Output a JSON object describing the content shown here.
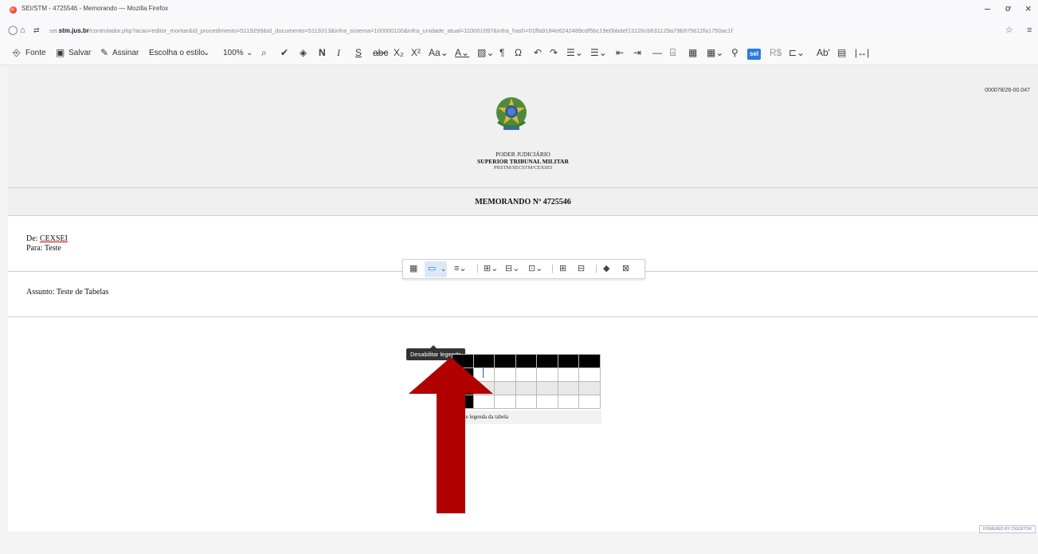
{
  "window": {
    "title": "SEI/STM - 4725546 - Memorando — Mozilla Firefox",
    "minimize": "–",
    "maximize": "ơ",
    "close": "×"
  },
  "address_bar": {
    "domain": "sei.stm.jus.br",
    "prefix": "sei.",
    "domain_bold": "stm.jus.br",
    "path": "/controlador.php?acao=editor_montar&id_procedimento=5119299&id_documento=5119313&infra_sistema=100000100&infra_unidade_atual=110001097&infra_hash=01ffa9184e6242489cdf5bc19e0bbdef13126cb631129a79b975612fa1750ac1f",
    "back_icon": "○",
    "lock_icon": "🔒",
    "star_icon": "☆",
    "menu_icon": "≡"
  },
  "toolbar": {
    "fonte": "Fonte",
    "salvar": "Salvar",
    "assinar": "Assinar",
    "style_select": "Escolha o estilo",
    "zoom": "100%",
    "sel_badge": "sel"
  },
  "document": {
    "doc_number": "000078/26-00.047",
    "header_line1": "PODER JUDICIÁRIO",
    "header_line2": "SUPERIOR TRIBUNAL MILITAR",
    "header_line3": "PRSTM/SECSTM/CEXSEI",
    "memo_title": "MEMORANDO Nº 4725546",
    "de_label": "De:",
    "de_value": "CEXSEI",
    "para_label": "Para:",
    "para_value": "Teste",
    "assunto": "Assunto: Teste de Tabelas",
    "table_caption": "Teste legenda da tabela"
  },
  "table_toolbar": {
    "tooltip": "Desabilitar legenda"
  },
  "footer": {
    "powered": "POWERED BY CKEDITOR"
  },
  "annotation": {
    "arrow_color": "#b00000"
  }
}
